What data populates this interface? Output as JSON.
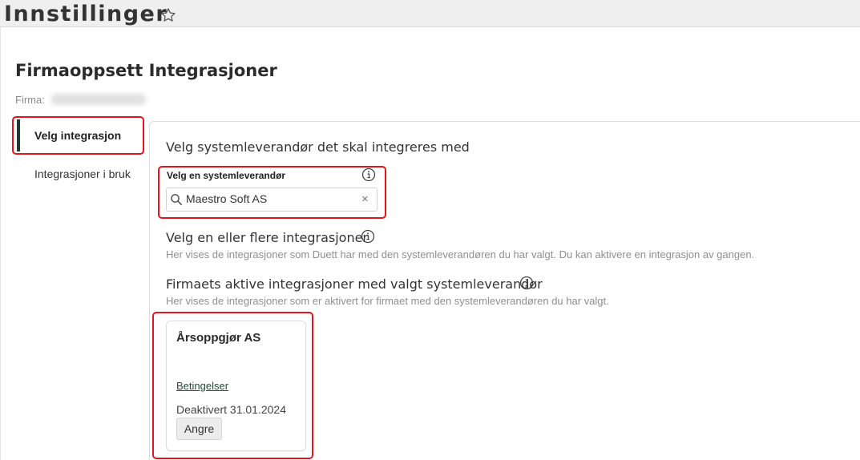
{
  "header": {
    "title": "Innstillinger",
    "favorite_icon": "star-outline-icon"
  },
  "section": {
    "title": "Firmaoppsett Integrasjoner",
    "firma_label": "Firma:",
    "firma_value": ""
  },
  "sidebar": {
    "items": [
      {
        "label": "Velg integrasjon",
        "active": true
      },
      {
        "label": "Integrasjoner i bruk",
        "active": false
      }
    ],
    "active_color": "#1f3b30"
  },
  "main": {
    "heading": "Velg systemleverandør det skal integreres med",
    "supplier": {
      "label": "Velg en systemleverandør",
      "value": "Maestro Soft AS",
      "placeholder": "",
      "info_icon": "info-circle-icon",
      "search_icon": "search-icon",
      "clear_icon": "close-icon"
    },
    "integrations": {
      "heading": "Velg en eller flere integrasjoner",
      "help": "Her vises de integrasjoner som Duett har med den systemleverandøren du har valgt. Du kan aktivere en integrasjon av gangen."
    },
    "active_integrations": {
      "heading": "Firmaets aktive integrasjoner med valgt systemleverandør",
      "help": "Her vises de integrasjoner som er aktivert for firmaet med den systemleverandøren du har valgt.",
      "cards": [
        {
          "title": "Årsoppgjør AS",
          "link_label": "Betingelser",
          "status": "Deaktivert 31.01.2024",
          "undo_label": "Angre"
        }
      ]
    }
  },
  "colors": {
    "highlight": "#e3141b",
    "link": "#1f4f38",
    "help_text": "#8f8f8f"
  }
}
